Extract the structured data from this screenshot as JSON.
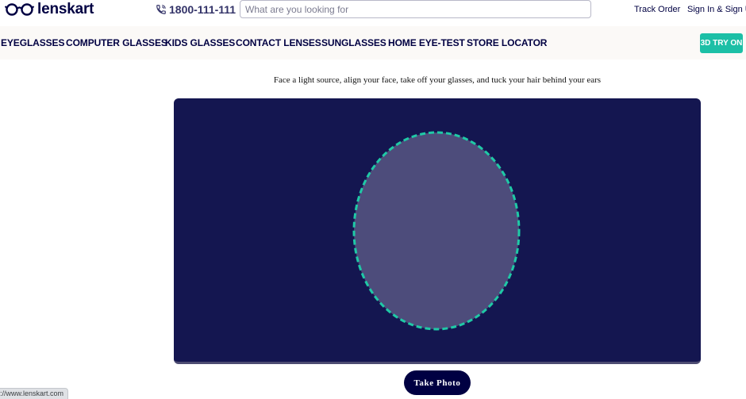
{
  "header": {
    "logo_text": "lenskart",
    "phone": "1800-111-111",
    "search_placeholder": "What are you looking for",
    "track_order": "Track Order",
    "sign_in": "Sign In & Sign Up"
  },
  "nav": {
    "items": [
      {
        "label": "EYEGLASSES"
      },
      {
        "label": "COMPUTER GLASSES"
      },
      {
        "label": "KIDS GLASSES"
      },
      {
        "label": "CONTACT LENSES"
      },
      {
        "label": "SUNGLASSES"
      },
      {
        "label": "HOME EYE-TEST"
      },
      {
        "label": "STORE LOCATOR"
      }
    ],
    "try_on": "3D TRY ON"
  },
  "main": {
    "instruction": "Face a light source, align your face, take off your glasses, and tuck your hair behind your ears",
    "take_photo": "Take Photo"
  },
  "status_bar": {
    "url": "://www.lenskart.com"
  },
  "colors": {
    "brand_navy": "#000042",
    "accent_teal": "#1cbfa6",
    "camera_bg": "#141650",
    "face_guide_fill": "#4d4c7b",
    "face_guide_stroke": "#1fc9a6"
  },
  "icons": {
    "logo": "glasses-logo-icon",
    "phone": "phone-icon"
  }
}
